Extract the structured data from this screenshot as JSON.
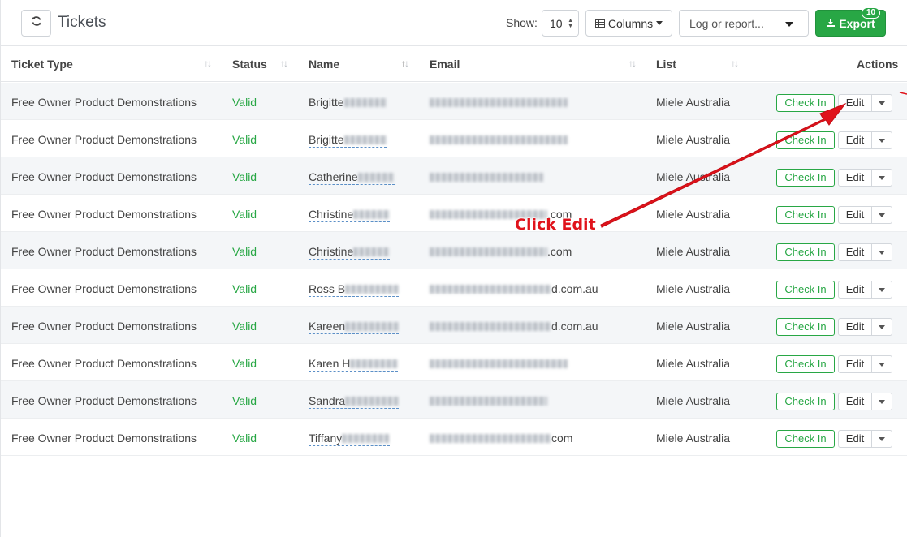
{
  "toolbar": {
    "title": "Tickets",
    "show_label": "Show:",
    "page_size": "10",
    "columns_label": "Columns",
    "report_placeholder": "Log or report...",
    "export_label": "Export",
    "export_count": "10"
  },
  "table": {
    "headers": {
      "ticket_type": "Ticket Type",
      "status": "Status",
      "name": "Name",
      "email": "Email",
      "list": "List",
      "actions": "Actions"
    },
    "checkin_label": "Check In",
    "edit_label": "Edit",
    "rows": [
      {
        "ticket_type": "Free Owner Product Demonstrations",
        "status": "Valid",
        "name": "Brigitte",
        "email": "",
        "list": "Miele Australia"
      },
      {
        "ticket_type": "Free Owner Product Demonstrations",
        "status": "Valid",
        "name": "Brigitte",
        "email": "",
        "list": "Miele Australia"
      },
      {
        "ticket_type": "Free Owner Product Demonstrations",
        "status": "Valid",
        "name": "Catherine",
        "email": "",
        "list": "Miele Australia"
      },
      {
        "ticket_type": "Free Owner Product Demonstrations",
        "status": "Valid",
        "name": "Christine",
        "email": ".com",
        "list": "Miele Australia"
      },
      {
        "ticket_type": "Free Owner Product Demonstrations",
        "status": "Valid",
        "name": "Christine",
        "email": ".com",
        "list": "Miele Australia"
      },
      {
        "ticket_type": "Free Owner Product Demonstrations",
        "status": "Valid",
        "name": "Ross B",
        "email": "d.com.au",
        "list": "Miele Australia"
      },
      {
        "ticket_type": "Free Owner Product Demonstrations",
        "status": "Valid",
        "name": "Kareen",
        "email": "d.com.au",
        "list": "Miele Australia"
      },
      {
        "ticket_type": "Free Owner Product Demonstrations",
        "status": "Valid",
        "name": "Karen H",
        "email": "",
        "list": "Miele Australia"
      },
      {
        "ticket_type": "Free Owner Product Demonstrations",
        "status": "Valid",
        "name": "Sandra",
        "email": "",
        "list": "Miele Australia"
      },
      {
        "ticket_type": "Free Owner Product Demonstrations",
        "status": "Valid",
        "name": "Tiffany",
        "email": "com",
        "list": "Miele Australia"
      }
    ]
  },
  "annotation": {
    "label": "Click Edit",
    "color": "#e0131b"
  },
  "colors": {
    "accent_green": "#28a745",
    "link_blue": "#5b8fc7"
  }
}
